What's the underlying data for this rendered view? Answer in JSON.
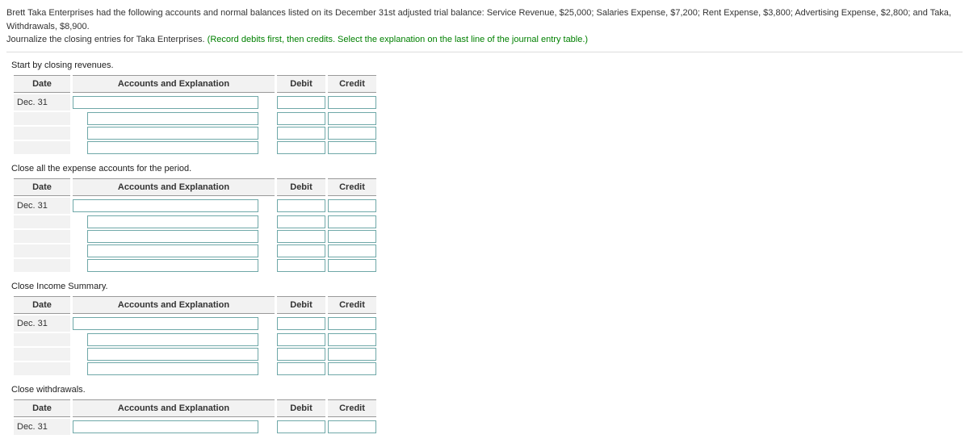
{
  "intro": {
    "line1": "Brett Taka Enterprises had the following accounts and normal balances listed on its December 31st adjusted trial balance: Service Revenue, $25,000; Salaries Expense, $7,200; Rent Expense, $3,800; Advertising Expense, $2,800; and Taka, Withdrawals, $8,900.",
    "line2_a": "Journalize the closing entries for Taka Enterprises. ",
    "line2_b": "(Record debits first, then credits. Select the explanation on the last line of the journal entry table.)"
  },
  "labels": {
    "date": "Date",
    "acct": "Accounts and Explanation",
    "debit": "Debit",
    "credit": "Credit",
    "dec31": "Dec. 31"
  },
  "steps": [
    {
      "title": "Start by closing revenues.",
      "rows": 4,
      "indentFrom": 1
    },
    {
      "title": "Close all the expense accounts for the period.",
      "rows": 5,
      "indentFrom": 1
    },
    {
      "title": "Close Income Summary.",
      "rows": 4,
      "indentFrom": 1
    },
    {
      "title": "Close withdrawals.",
      "rows": 1,
      "indentFrom": 99
    }
  ]
}
